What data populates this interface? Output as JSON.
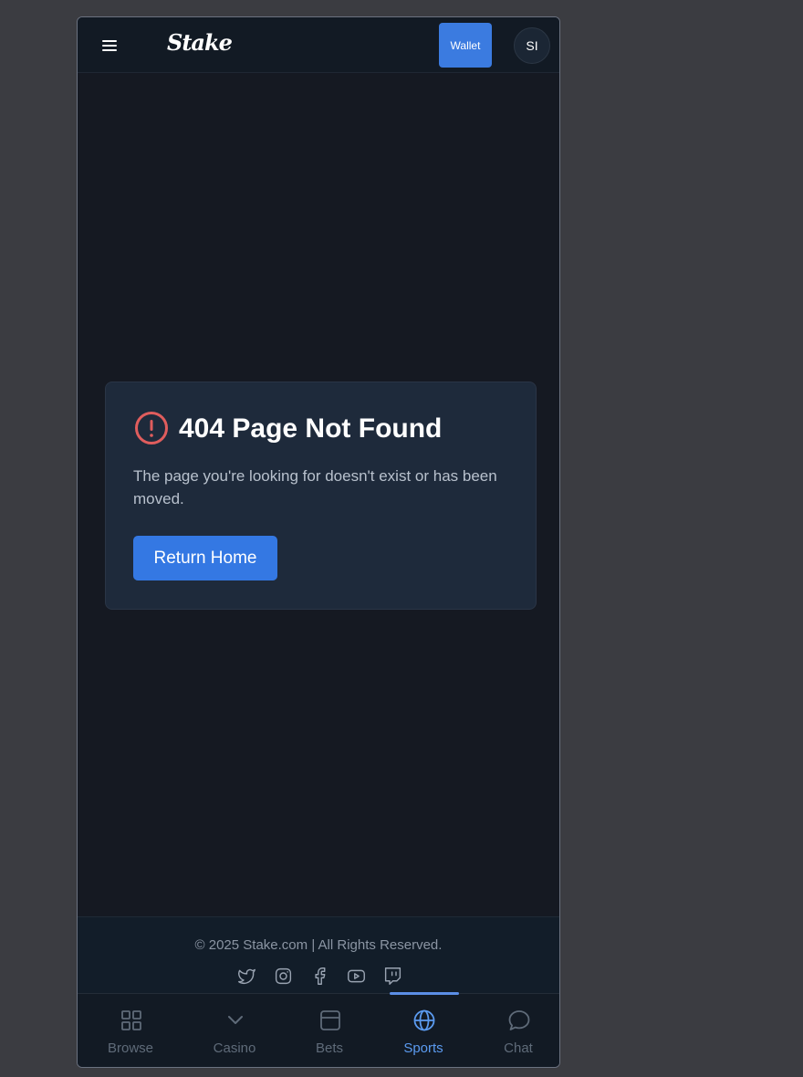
{
  "header": {
    "logo_text": "Stake",
    "wallet_label": "Wallet",
    "avatar_initials": "SI"
  },
  "error": {
    "title": "404 Page Not Found",
    "message": "The page you're looking for doesn't exist or has been moved.",
    "button_label": "Return Home",
    "icon": "alert-circle-icon",
    "icon_color": "#e05d5d"
  },
  "footer": {
    "copyright": "© 2025 Stake.com | All Rights Reserved.",
    "socials": [
      "twitter-icon",
      "instagram-icon",
      "facebook-icon",
      "youtube-icon",
      "twitch-icon"
    ]
  },
  "bottom_nav": {
    "items": [
      {
        "label": "Browse",
        "icon": "grid-icon"
      },
      {
        "label": "Casino",
        "icon": "chevron-down-icon"
      },
      {
        "label": "Bets",
        "icon": "betslip-icon"
      },
      {
        "label": "Sports",
        "icon": "globe-icon"
      },
      {
        "label": "Chat",
        "icon": "chat-bubble-icon"
      }
    ],
    "active": "Sports"
  },
  "colors": {
    "background": "#151922",
    "card": "#1e2a3b",
    "accent": "#3478e3",
    "active_nav": "#5b9bf0"
  }
}
